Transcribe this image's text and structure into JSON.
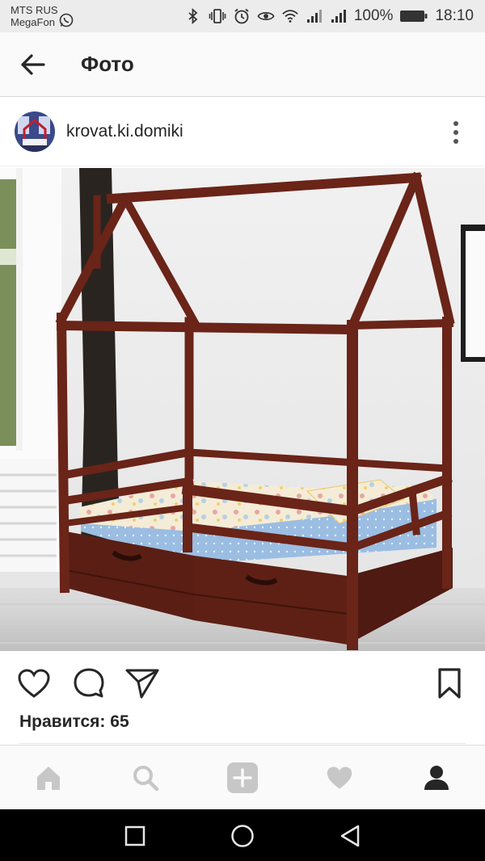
{
  "status_bar": {
    "carrier_1": "MTS RUS",
    "carrier_2": "MegaFon",
    "battery": "100%",
    "time": "18:10",
    "icons": [
      "whatsapp-icon",
      "bluetooth-icon",
      "vibrate-icon",
      "alarm-icon",
      "eye-icon",
      "wifi-icon",
      "signal-icon",
      "signal-icon",
      "battery-icon"
    ]
  },
  "header": {
    "title": "Фото",
    "back_icon": "arrow-left-icon"
  },
  "post": {
    "username": "krovat.ki.domiki",
    "avatar_icon": "avatar",
    "more_icon": "more-vertical-icon",
    "photo": "house-bed-photo",
    "likes": "Нравится: 65",
    "actions": [
      "heart-icon",
      "comment-icon",
      "send-icon",
      "bookmark-icon"
    ]
  },
  "bottom_nav": {
    "items": [
      "home-icon",
      "search-icon",
      "add-icon",
      "activity-heart-icon",
      "profile-icon"
    ]
  },
  "system_nav": {
    "items": [
      "recent-apps-square-icon",
      "home-circle-icon",
      "back-triangle-icon"
    ]
  },
  "colors": {
    "wood": "#6a2418",
    "mattress": "#9bbde2",
    "wall": "#efefef",
    "nav_icon_inactive": "#c7c7c7",
    "nav_icon_active": "#262626"
  }
}
